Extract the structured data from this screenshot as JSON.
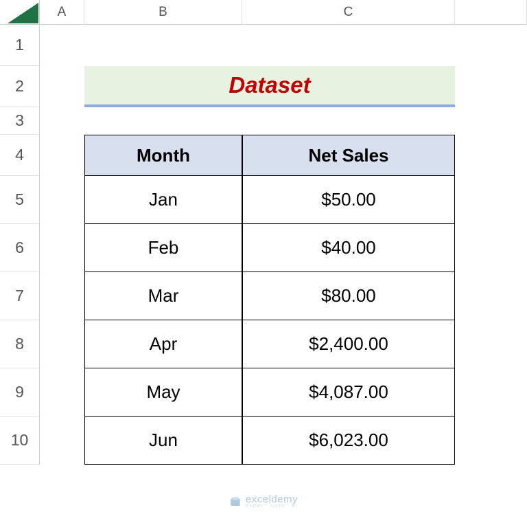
{
  "columns": [
    "A",
    "B",
    "C",
    ""
  ],
  "rows": [
    "1",
    "2",
    "3",
    "4",
    "5",
    "6",
    "7",
    "8",
    "9",
    "10"
  ],
  "title": "Dataset",
  "table": {
    "headers": [
      "Month",
      "Net Sales"
    ],
    "data": [
      {
        "month": "Jan",
        "sales": "$50.00"
      },
      {
        "month": "Feb",
        "sales": "$40.00"
      },
      {
        "month": "Mar",
        "sales": "$80.00"
      },
      {
        "month": "Apr",
        "sales": "$2,400.00"
      },
      {
        "month": "May",
        "sales": "$4,087.00"
      },
      {
        "month": "Jun",
        "sales": "$6,023.00"
      }
    ]
  },
  "watermark": {
    "main": "exceldemy",
    "sub": "EXCEL · DATA · BI"
  }
}
